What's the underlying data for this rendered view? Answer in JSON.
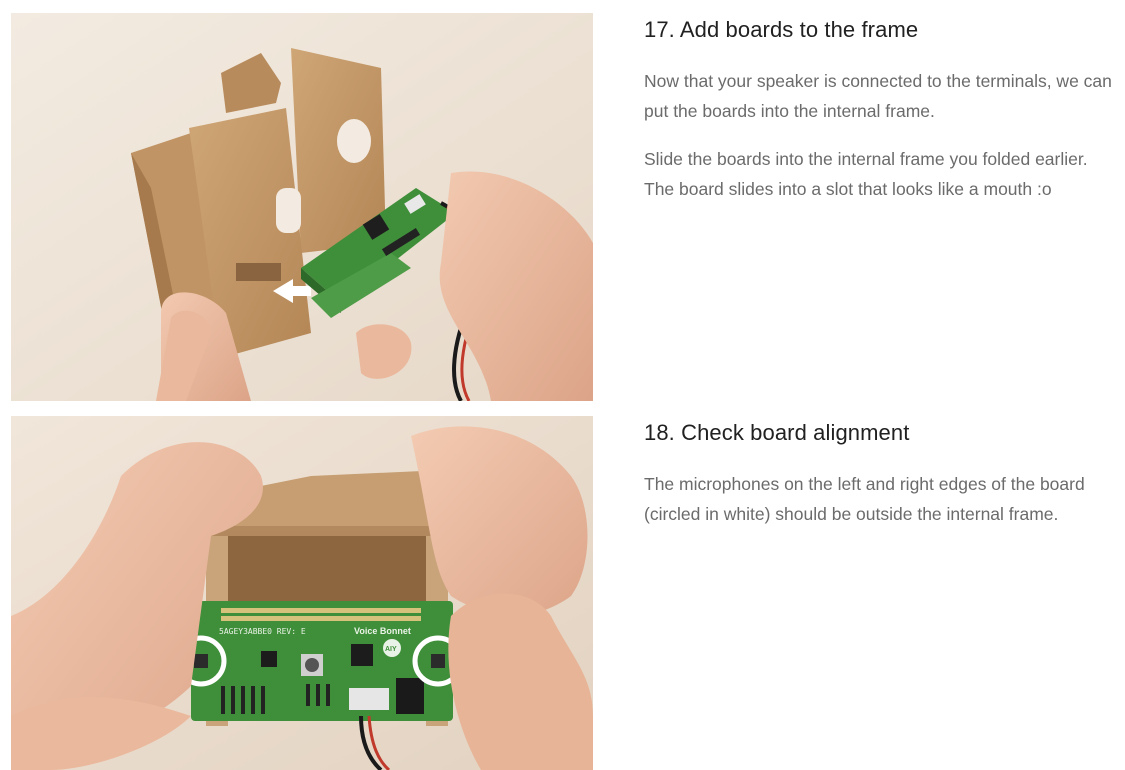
{
  "steps": [
    {
      "title": "17. Add boards to the frame",
      "paragraphs": [
        "Now that your speaker is connected to the terminals, we can put the boards into the internal frame.",
        "Slide the boards into the internal frame you folded earlier. The board slides into a slot that looks like a mouth :o"
      ]
    },
    {
      "title": "18. Check board alignment",
      "paragraphs": [
        "The microphones on the left and right edges of the board (circled in white) should be outside the internal frame."
      ],
      "board_labels": {
        "brand": "Voice Bonnet",
        "serial": "5AGEY3ABBE0  REV: E",
        "badge": "AIY"
      }
    }
  ],
  "colors": {
    "heading": "#212121",
    "body_text": "#6b6b6b",
    "pcb_green": "#3f8f3a",
    "cardboard": "#c49a6a"
  }
}
